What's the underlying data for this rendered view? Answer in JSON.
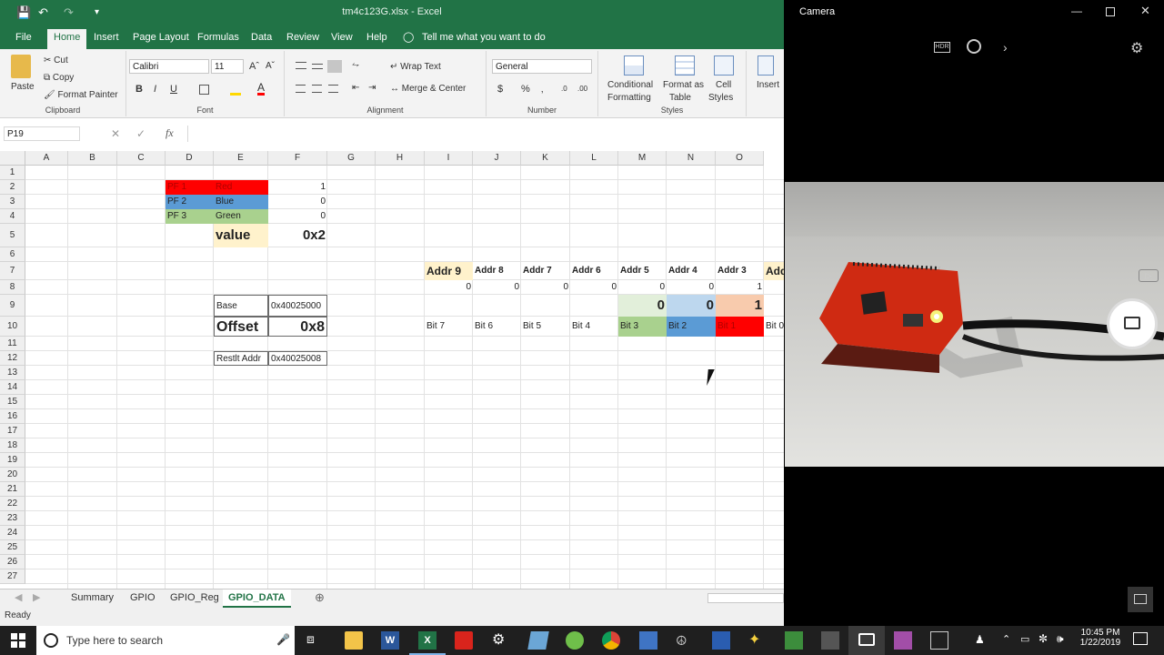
{
  "excel": {
    "title": "tm4c123G.xlsx  -  Excel",
    "menu": [
      "File",
      "Home",
      "Insert",
      "Page Layout",
      "Formulas",
      "Data",
      "Review",
      "View",
      "Help"
    ],
    "tell_me": "Tell me what you want to do",
    "ribbon": {
      "paste": "Paste",
      "cut": "Cut",
      "copy": "Copy",
      "format_painter": "Format Painter",
      "clipboard": "Clipboard",
      "font_name": "Calibri",
      "font_size": "11",
      "font_group": "Font",
      "wrap_text": "Wrap Text",
      "merge_center": "Merge & Center",
      "alignment": "Alignment",
      "number_format": "General",
      "number_group": "Number",
      "conditional_1": "Conditional",
      "conditional_2": "Formatting",
      "format_as_1": "Format as",
      "format_as_2": "Table",
      "cell_styles_1": "Cell",
      "cell_styles_2": "Styles",
      "styles_group": "Styles",
      "insert": "Insert"
    },
    "name_box": "P19",
    "columns": [
      "A",
      "B",
      "C",
      "D",
      "E",
      "F",
      "G",
      "H",
      "I",
      "J",
      "K",
      "L",
      "M",
      "N",
      "O"
    ],
    "rows": [
      "1",
      "2",
      "3",
      "4",
      "5",
      "6",
      "7",
      "8",
      "9",
      "10",
      "11",
      "12",
      "13",
      "14",
      "15",
      "16",
      "17",
      "18",
      "19",
      "20",
      "21",
      "22",
      "23",
      "24",
      "25",
      "26",
      "27"
    ],
    "cells": {
      "d2": "PF 1",
      "e2": "Red",
      "f2": "1",
      "d3": "PF 2",
      "e3": "Blue",
      "f3": "0",
      "d4": "PF 3",
      "e4": "Green",
      "f4": "0",
      "e5": "value",
      "f5": "0x2",
      "e9": "Base",
      "f9": "0x40025000",
      "e10": "Offset",
      "f10": "0x8",
      "e12": "Restlt Addr",
      "f12": "0x40025008"
    },
    "addr_headers": [
      "Addr 9",
      "Addr 8",
      "Addr 7",
      "Addr 6",
      "Addr 5",
      "Addr 4",
      "Addr 3",
      "Addr"
    ],
    "row8": [
      "0",
      "0",
      "0",
      "0",
      "0",
      "0",
      "1"
    ],
    "row9": [
      "0",
      "0",
      "1"
    ],
    "bits": [
      "Bit 7",
      "Bit 6",
      "Bit 5",
      "Bit 4",
      "Bit 3",
      "Bit 2",
      "Bit 1",
      "Bit 0"
    ],
    "sheet_tabs": [
      "Summary",
      "GPIO",
      "GPIO_Reg",
      "GPIO_DATA"
    ],
    "status": "Ready"
  },
  "camera": {
    "title": "Camera"
  },
  "taskbar": {
    "search_placeholder": "Type here to search",
    "time": "10:45 PM",
    "date": "1/22/2019"
  },
  "colors": {
    "excel_green": "#217346",
    "red_fill": "#ff0000",
    "blue_fill": "#5b9bd5",
    "green_fill": "#a9d18e",
    "yellow_fill": "#fff2cc",
    "light_green": "#e2efda",
    "light_blue": "#bdd7ee",
    "peach": "#f8cbad"
  }
}
